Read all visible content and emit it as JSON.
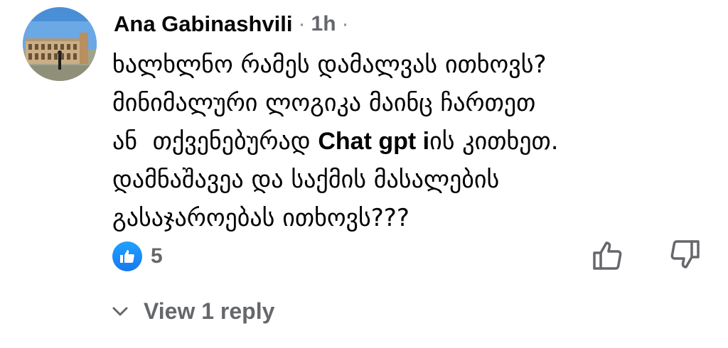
{
  "comment": {
    "author": "Ana Gabinashvili",
    "separator_dot": "·",
    "time": "1h",
    "time_suffix_dot": "·",
    "lines": [
      {
        "text": "ხალხლნო რამეს დამალვას ითხოვს?"
      },
      {
        "text": "მინიმალური ლოგიკა მაინც ჩართეთ"
      },
      {
        "text_before": "ან  თქვენებურად ",
        "latin": "Chat gpt i",
        "text_after": "ის კითხეთ."
      },
      {
        "text": "დამნაშავეა და საქმის მასალების"
      },
      {
        "text": "გასაჯაროებას ითხოვს???"
      }
    ],
    "reaction_count": "5",
    "view_replies": "View 1 reply"
  },
  "colors": {
    "like_blue": "#1877f2",
    "secondary_text": "#65676b"
  },
  "icons": {
    "avatar": "colosseum-photo",
    "reaction": "thumbs-up-icon",
    "upvote": "thumbs-up-outline-icon",
    "downvote": "thumbs-down-outline-icon",
    "expand": "chevron-down-icon"
  }
}
